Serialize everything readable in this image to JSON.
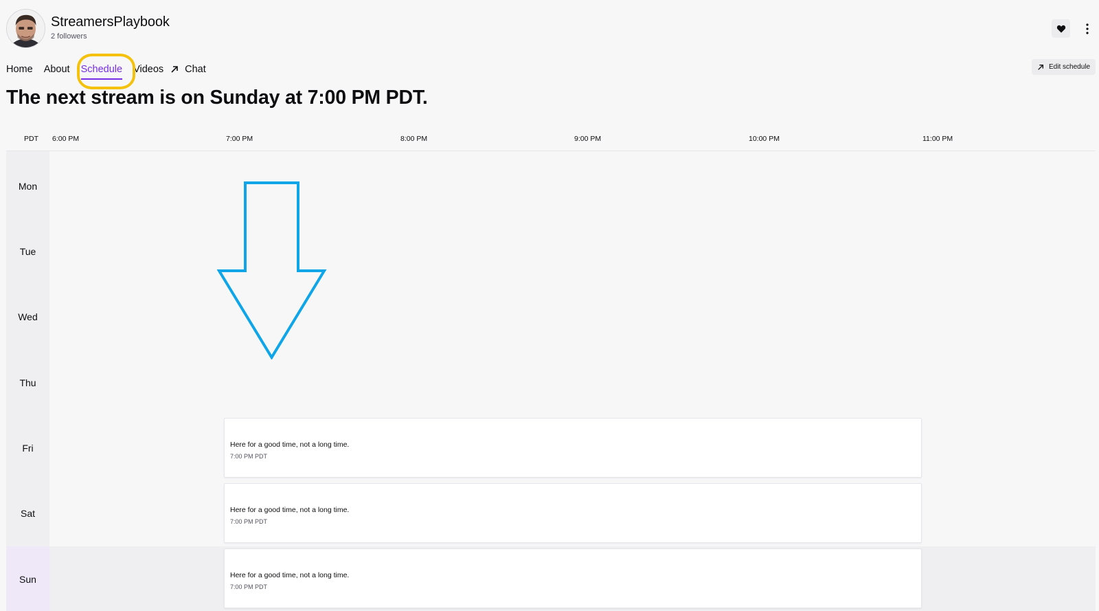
{
  "channel": {
    "name": "StreamersPlaybook",
    "followers": "2 followers"
  },
  "nav": {
    "home": "Home",
    "about": "About",
    "schedule": "Schedule",
    "videos": "Videos",
    "chat": "Chat"
  },
  "actions": {
    "edit_schedule": "Edit schedule"
  },
  "headline": "The next stream is on Sunday at 7:00 PM PDT.",
  "schedule": {
    "timezone": "PDT",
    "times": [
      "6:00 PM",
      "7:00 PM",
      "8:00 PM",
      "9:00 PM",
      "10:00 PM",
      "11:00 PM"
    ],
    "days": [
      "Mon",
      "Tue",
      "Wed",
      "Thu",
      "Fri",
      "Sat",
      "Sun"
    ],
    "today": "Sun",
    "events": [
      {
        "day": "Fri",
        "title": "Here for a good time, not a long time.",
        "time": "7:00 PM PDT"
      },
      {
        "day": "Sat",
        "title": "Here for a good time, not a long time.",
        "time": "7:00 PM PDT"
      },
      {
        "day": "Sun",
        "title": "Here for a good time, not a long time.",
        "time": "7:00 PM PDT"
      }
    ]
  },
  "colors": {
    "accent": "#772ce8",
    "annotation_circle": "#f4c20d",
    "annotation_arrow": "#0ea5e9"
  },
  "icons": {
    "follow": "heart-icon",
    "more": "more-vertical-icon",
    "chat": "external-link-arrow-icon",
    "edit": "external-link-arrow-icon"
  }
}
